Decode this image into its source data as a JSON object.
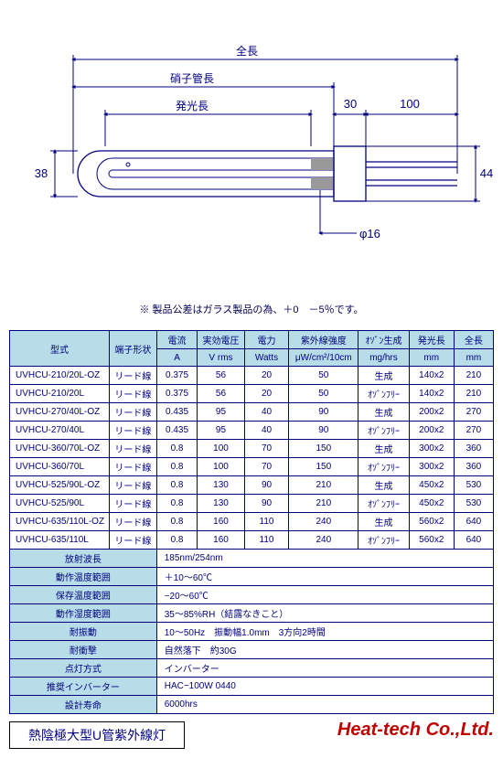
{
  "domain": "Document",
  "diagram": {
    "dim_total_length": "全長",
    "dim_glass_length": "硝子管長",
    "dim_light_length": "発光長",
    "dim_left_height": "38",
    "dim_right_height": "44",
    "dim_connector": "30",
    "dim_lead": "100",
    "dim_tube_dia": "φ16"
  },
  "note": "※ 製品公差はガラス製品の為、＋0　－5％です。",
  "table": {
    "headers": {
      "model": "型式",
      "terminal": "端子形状",
      "current": "電流",
      "voltage": "実効電圧",
      "power": "電力",
      "uv_intensity": "紫外線強度",
      "ozone": "ｵｿﾞﾝ生成",
      "light_len": "発光長",
      "total_len": "全長"
    },
    "units": {
      "current": "A",
      "voltage": "V rms",
      "power": "Watts",
      "uv_intensity": "μW/cm²/10cm",
      "ozone": "mg/hrs",
      "light_len": "mm",
      "total_len": "mm"
    },
    "rows": [
      {
        "model": "UVHCU-210/20L-OZ",
        "terminal": "リード線",
        "A": "0.375",
        "V": "56",
        "W": "20",
        "UV": "50",
        "ozone": "生成",
        "LL": "140x2",
        "TL": "210"
      },
      {
        "model": "UVHCU-210/20L",
        "terminal": "リード線",
        "A": "0.375",
        "V": "56",
        "W": "20",
        "UV": "50",
        "ozone": "ｵｿﾞﾝﾌﾘｰ",
        "LL": "140x2",
        "TL": "210"
      },
      {
        "model": "UVHCU-270/40L-OZ",
        "terminal": "リード線",
        "A": "0.435",
        "V": "95",
        "W": "40",
        "UV": "90",
        "ozone": "生成",
        "LL": "200x2",
        "TL": "270"
      },
      {
        "model": "UVHCU-270/40L",
        "terminal": "リード線",
        "A": "0.435",
        "V": "95",
        "W": "40",
        "UV": "90",
        "ozone": "ｵｿﾞﾝﾌﾘｰ",
        "LL": "200x2",
        "TL": "270"
      },
      {
        "model": "UVHCU-360/70L-OZ",
        "terminal": "リード線",
        "A": "0.8",
        "V": "100",
        "W": "70",
        "UV": "150",
        "ozone": "生成",
        "LL": "300x2",
        "TL": "360"
      },
      {
        "model": "UVHCU-360/70L",
        "terminal": "リード線",
        "A": "0.8",
        "V": "100",
        "W": "70",
        "UV": "150",
        "ozone": "ｵｿﾞﾝﾌﾘｰ",
        "LL": "300x2",
        "TL": "360"
      },
      {
        "model": "UVHCU-525/90L-OZ",
        "terminal": "リード線",
        "A": "0.8",
        "V": "130",
        "W": "90",
        "UV": "210",
        "ozone": "生成",
        "LL": "450x2",
        "TL": "530"
      },
      {
        "model": "UVHCU-525/90L",
        "terminal": "リード線",
        "A": "0.8",
        "V": "130",
        "W": "90",
        "UV": "210",
        "ozone": "ｵｿﾞﾝﾌﾘｰ",
        "LL": "450x2",
        "TL": "530"
      },
      {
        "model": "UVHCU-635/110L-OZ",
        "terminal": "リード線",
        "A": "0.8",
        "V": "160",
        "W": "110",
        "UV": "240",
        "ozone": "生成",
        "LL": "560x2",
        "TL": "640"
      },
      {
        "model": "UVHCU-635/110L",
        "terminal": "リード線",
        "A": "0.8",
        "V": "160",
        "W": "110",
        "UV": "240",
        "ozone": "ｵｿﾞﾝﾌﾘｰ",
        "LL": "560x2",
        "TL": "640"
      }
    ],
    "specs": [
      {
        "label": "放射波長",
        "value": "185nm/254nm"
      },
      {
        "label": "動作温度範囲",
        "value": "＋10〜60℃"
      },
      {
        "label": "保存温度範囲",
        "value": "−20〜60℃"
      },
      {
        "label": "動作湿度範囲",
        "value": "35〜85%RH（結露なきこと）"
      },
      {
        "label": "耐振動",
        "value": "10〜50Hz　振動幅1.0mm　3方向2時間"
      },
      {
        "label": "耐衝撃",
        "value": "自然落下　約30G"
      },
      {
        "label": "点灯方式",
        "value": "インバーター"
      },
      {
        "label": "推奨インバーター",
        "value": "HAC−100W 0440"
      },
      {
        "label": "設計寿命",
        "value": "6000hrs"
      }
    ]
  },
  "footer": {
    "title": "熱陰極大型U管紫外線灯",
    "company": "Heat-tech Co.,Ltd."
  }
}
